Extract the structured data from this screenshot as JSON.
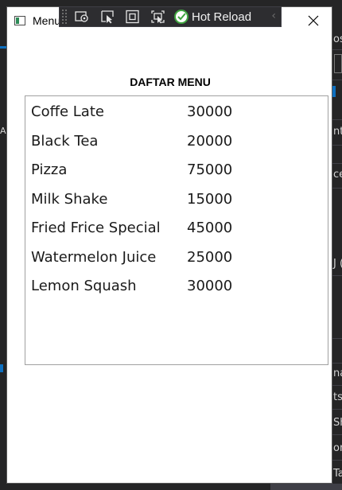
{
  "window": {
    "title": "Menu",
    "close_glyph": "✕"
  },
  "debug_toolbar": {
    "hot_reload_label": "Hot Reload",
    "collapse_glyph": "‹",
    "icons": [
      "live-visual-tree-icon",
      "select-element-icon",
      "display-layout-adorners-icon",
      "track-focus-icon",
      "hot-reload-icon"
    ]
  },
  "content": {
    "heading": "DAFTAR MENU",
    "items": [
      {
        "name": "Coffe Late",
        "price": "30000"
      },
      {
        "name": "Black Tea",
        "price": "20000"
      },
      {
        "name": "Pizza",
        "price": "75000"
      },
      {
        "name": "Milk Shake",
        "price": "15000"
      },
      {
        "name": "Fried Frice Special",
        "price": "45000"
      },
      {
        "name": "Watermelon Juice",
        "price": "25000"
      },
      {
        "name": "Lemon Squash",
        "price": "30000"
      }
    ]
  },
  "background_fragments": [
    "os",
    "A",
    "nt",
    "ce",
    "J (",
    "na",
    "ts",
    "Sh",
    "on",
    "Ta"
  ],
  "colors": {
    "toolbar_bg": "#2d2d30",
    "hot_reload_green": "#3fa53f",
    "list_border": "#a0a0a0"
  }
}
